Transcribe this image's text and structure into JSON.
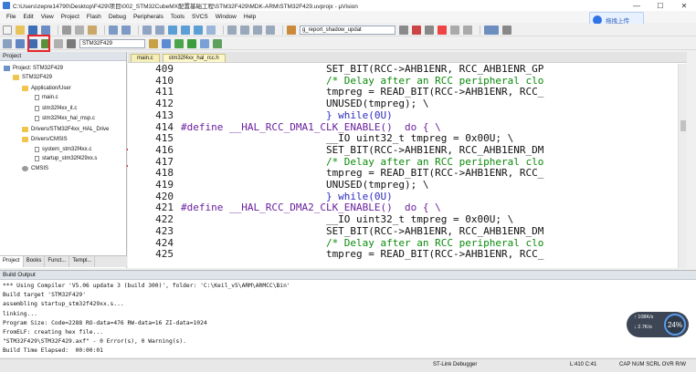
{
  "window": {
    "title": "C:\\Users\\zepre14790\\Desktop\\F429\\项目\\002_STM32CubeMX配置基础工程\\STM32F429\\MDK-ARM\\STM32F429.uvprojx - µVision"
  },
  "menu": [
    "File",
    "Edit",
    "View",
    "Project",
    "Flash",
    "Debug",
    "Peripherals",
    "Tools",
    "SVCS",
    "Window",
    "Help"
  ],
  "cloud_button": {
    "label": "拖拽上传"
  },
  "toolbar": {
    "target_combo": "STM32F429",
    "find_combo": "g_report_shadow_updat"
  },
  "project_panel": {
    "title": "Project",
    "tree": [
      "Project: STM32F429",
      "STM32F429",
      "Application/User",
      "main.c",
      "stm32f4xx_it.c",
      "stm32f4xx_hal_msp.c",
      "Drivers/STM32F4xx_HAL_Drive",
      "Drivers/CMSIS",
      "system_stm32f4xx.c",
      "startup_stm32f429xx.s",
      "CMSIS"
    ],
    "tabs": [
      "Project",
      "Books",
      "Funct...",
      "Templ..."
    ]
  },
  "editor": {
    "tabs": [
      "main.c",
      "stm32f4xx_hal_rcc.h"
    ],
    "lines": [
      {
        "num": "409",
        "text": "                        SET_BIT(RCC->AHB1ENR, RCC_AHB1ENR_GP",
        "cls": ""
      },
      {
        "num": "410",
        "text": "                        /* Delay after an RCC peripheral clo",
        "cls": "comment"
      },
      {
        "num": "411",
        "text": "                        tmpreg = READ_BIT(RCC->AHB1ENR, RCC_",
        "cls": ""
      },
      {
        "num": "412",
        "text": "                        UNUSED(tmpreg); \\",
        "cls": ""
      },
      {
        "num": "413",
        "text": "                        } while(0U)",
        "cls": "kw"
      },
      {
        "num": "414",
        "text": "#define __HAL_RCC_DMA1_CLK_ENABLE()  do { \\",
        "cls": "define"
      },
      {
        "num": "415",
        "text": "                        __IO uint32_t tmpreg = 0x00U; \\",
        "cls": ""
      },
      {
        "num": "416",
        "text": "                        SET_BIT(RCC->AHB1ENR, RCC_AHB1ENR_DM",
        "cls": ""
      },
      {
        "num": "417",
        "text": "                        /* Delay after an RCC peripheral clo",
        "cls": "comment"
      },
      {
        "num": "418",
        "text": "                        tmpreg = READ_BIT(RCC->AHB1ENR, RCC_",
        "cls": ""
      },
      {
        "num": "419",
        "text": "                        UNUSED(tmpreg); \\",
        "cls": ""
      },
      {
        "num": "420",
        "text": "                        } while(0U)",
        "cls": "kw"
      },
      {
        "num": "421",
        "text": "#define __HAL_RCC_DMA2_CLK_ENABLE()  do { \\",
        "cls": "define"
      },
      {
        "num": "422",
        "text": "                        __IO uint32_t tmpreg = 0x00U; \\",
        "cls": ""
      },
      {
        "num": "423",
        "text": "                        SET_BIT(RCC->AHB1ENR, RCC_AHB1ENR_DM",
        "cls": ""
      },
      {
        "num": "424",
        "text": "                        /* Delay after an RCC peripheral clo",
        "cls": "comment"
      },
      {
        "num": "425",
        "text": "                        tmpreg = READ_BIT(RCC->AHB1ENR, RCC_",
        "cls": ""
      }
    ]
  },
  "build_output": {
    "title": "Build Output",
    "lines": [
      "*** Using Compiler 'V5.06 update 3 (build 300)', folder: 'C:\\Keil_v5\\ARM\\ARMCC\\Bin'",
      "Build target 'STM32F429'",
      "assembling startup_stm32f429xx.s...",
      "linking...",
      "Program Size: Code=2288 RO-data=476 RW-data=16 ZI-data=1024",
      "FromELF: creating hex file...",
      "\"STM32F429\\STM32F429.axf\" - 0 Error(s), 0 Warning(s).",
      "Build Time Elapsed:  00:00:01"
    ]
  },
  "status_bar": {
    "debugger": "ST-Link Debugger",
    "position": "L:410 C:41",
    "indicators": "CAP  NUM  SCRL  OVR  R/W"
  },
  "net_widget": {
    "up": "↑ 108K/s",
    "down": "↓ 2.7K/s",
    "percent": "24%"
  },
  "colors": {
    "highlight": "#e8262a",
    "define": "#6a1f9e",
    "comment": "#0b8a0b",
    "keyword": "#2b2bbd"
  }
}
